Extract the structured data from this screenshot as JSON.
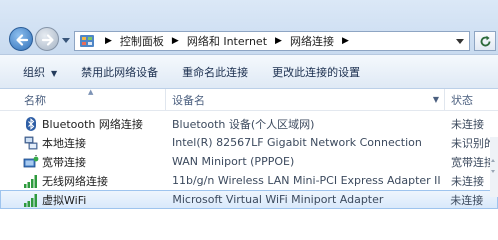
{
  "breadcrumb": [
    "控制面板",
    "网络和 Internet",
    "网络连接"
  ],
  "toolbar": {
    "organize": "组织",
    "disable": "禁用此网络设备",
    "rename": "重命名此连接",
    "change": "更改此连接的设置"
  },
  "columns": {
    "name": "名称",
    "device": "设备名",
    "status": "状态"
  },
  "connections": [
    {
      "name": "Bluetooth 网络连接",
      "device": "Bluetooth 设备(个人区域网)",
      "status": "未连接",
      "icon": "bluetooth-icon"
    },
    {
      "name": "本地连接",
      "device": "Intel(R) 82567LF Gigabit Network Connection",
      "status": "未识别的网络",
      "icon": "lan-icon"
    },
    {
      "name": "宽带连接",
      "device": "WAN Miniport (PPPOE)",
      "status": "宽带连接",
      "icon": "broadband-icon"
    },
    {
      "name": "无线网络连接",
      "device": "11b/g/n  Wireless LAN Mini-PCI Express Adapter II",
      "status": "未连接",
      "icon": "wireless-signal-icon"
    },
    {
      "name": "虚拟WiFi",
      "device": "Microsoft Virtual WiFi Miniport Adapter",
      "status": "未连接",
      "icon": "wireless-signal-icon",
      "selected": true
    }
  ]
}
